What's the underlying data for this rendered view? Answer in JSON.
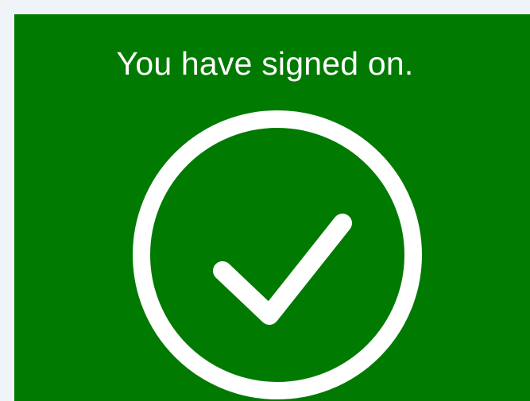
{
  "message": {
    "title": "You have signed on."
  },
  "status_icon": {
    "name": "check-circle-icon",
    "state": "success"
  },
  "colors": {
    "page_background": "#f0f3f8",
    "panel_background": "#017a01",
    "foreground": "#ffffff"
  }
}
